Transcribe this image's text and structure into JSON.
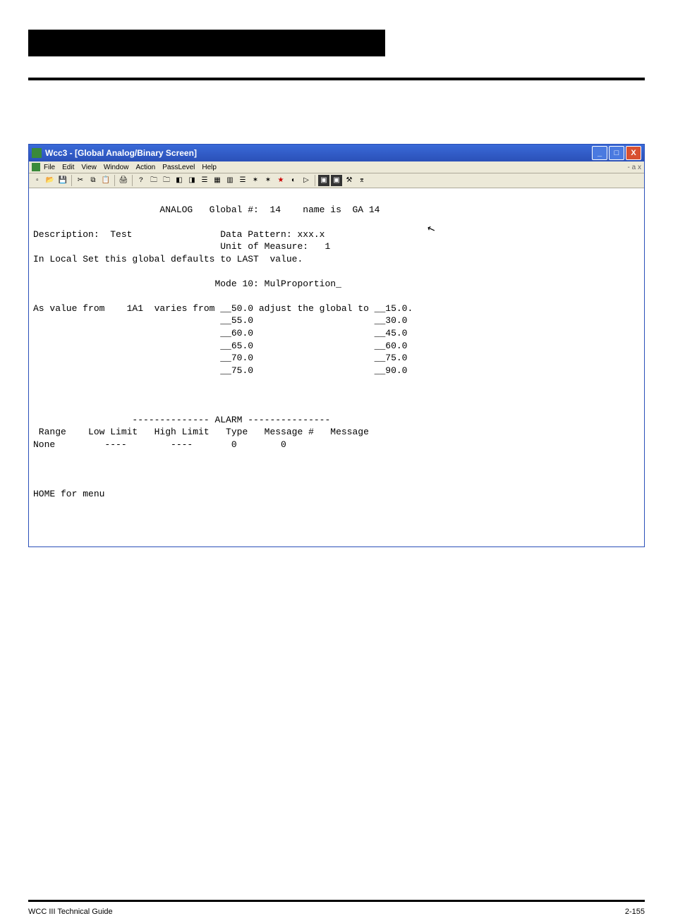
{
  "titlebar": {
    "text": "Wcc3 - [Global Analog/Binary Screen]"
  },
  "menubar": {
    "items": [
      "File",
      "Edit",
      "View",
      "Window",
      "Action",
      "PassLevel",
      "Help"
    ],
    "right": "- a x"
  },
  "content": {
    "header_line": "                       ANALOG   Global #:  14    name is  GA 14",
    "desc_line": "Description:  Test                Data Pattern: xxx.x",
    "unit_line": "                                  Unit of Measure:   1",
    "local_line": "In Local Set this global defaults to LAST  value.",
    "mode_line": "                                 Mode 10: MulProportion_",
    "body_line1": "As value from    1A1  varies from __50.0 adjust the global to __15.0.",
    "body_line2": "                                  __55.0                      __30.0",
    "body_line3": "                                  __60.0                      __45.0",
    "body_line4": "                                  __65.0                      __60.0",
    "body_line5": "                                  __70.0                      __75.0",
    "body_line6": "                                  __75.0                      __90.0",
    "alarm_hdr": "                  -------------- ALARM ---------------",
    "alarm_cols": " Range    Low Limit   High Limit   Type   Message #   Message",
    "alarm_row": "None         ----        ----       0        0",
    "footer_line": "HOME for menu"
  },
  "page_footer": {
    "left": "WCC III Technical Guide",
    "right": "2-155"
  }
}
